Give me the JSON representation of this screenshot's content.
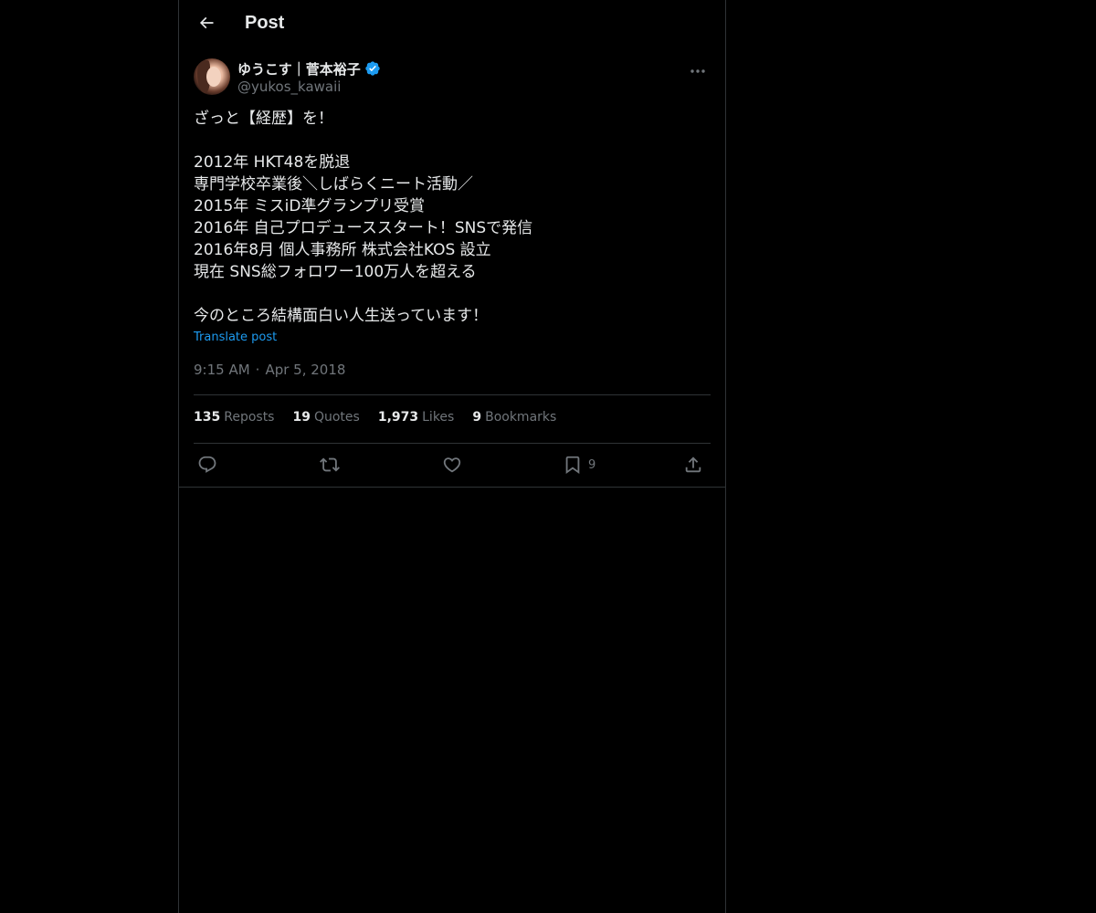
{
  "header": {
    "back_icon": "back-arrow-icon",
    "title": "Post"
  },
  "author": {
    "display_name": "ゆうこす｜菅本裕子",
    "verified_icon": "verified-badge-icon",
    "handle": "@yukos_kawaii",
    "more_icon": "more-dots-icon"
  },
  "post": {
    "lines": [
      "ざっと【経歴】を！",
      "",
      "2012年 HKT48を脱退",
      "専門学校卒業後＼しばらくニート活動／",
      "2015年 ミスiD準グランプリ受賞",
      "2016年 自己プロデューススタート！SNSで発信",
      "2016年8月 個人事務所  株式会社KOS 設立",
      "現在 SNS総フォロワー100万人を超える",
      "",
      "今のところ結構面白い人生送っています！"
    ],
    "translate_label": "Translate post",
    "time": "9:15 AM",
    "separator": "·",
    "date": "Apr 5, 2018"
  },
  "stats": [
    {
      "count": "135",
      "label": "Reposts"
    },
    {
      "count": "19",
      "label": "Quotes"
    },
    {
      "count": "1,973",
      "label": "Likes"
    },
    {
      "count": "9",
      "label": "Bookmarks"
    }
  ],
  "actions": {
    "reply_icon": "reply-icon",
    "repost_icon": "repost-icon",
    "like_icon": "heart-icon",
    "bookmark_icon": "bookmark-icon",
    "bookmark_count": "9",
    "share_icon": "share-icon"
  },
  "colors": {
    "background": "#000000",
    "text": "#e7e9ea",
    "muted": "#71767b",
    "border": "#2f3336",
    "accent": "#1d9bf0"
  }
}
